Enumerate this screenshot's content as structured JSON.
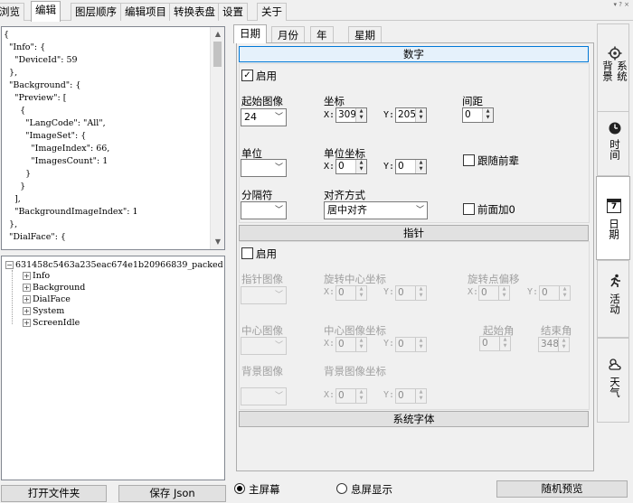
{
  "top_tabs": [
    "浏览",
    "编辑",
    "图层顺序",
    "编辑项目",
    "转换表盘",
    "设置",
    "关于"
  ],
  "active_top_tab": "编辑",
  "window_hint": "▾ ? ×",
  "json_lines": [
    "{",
    "  \"Info\": {",
    "    \"DeviceId\": 59",
    "  },",
    "  \"Background\": {",
    "    \"Preview\": [",
    "      {",
    "        \"LangCode\": \"All\",",
    "        \"ImageSet\": {",
    "          \"ImageIndex\": 66,",
    "          \"ImagesCount\": 1",
    "        }",
    "      }",
    "    ],",
    "    \"BackgroundImageIndex\": 1",
    "  },",
    "  \"DialFace\": {"
  ],
  "tree": {
    "root": "631458c5463a235eac674e1b20966839_packed",
    "children": [
      "Info",
      "Background",
      "DialFace",
      "System",
      "ScreenIdle"
    ]
  },
  "buttons": {
    "open_folder": "打开文件夹",
    "save_json": "保存 Json",
    "random_preview": "随机预览"
  },
  "sub_tabs": [
    "日期",
    "月份",
    "年",
    "星期"
  ],
  "active_sub_tab": "日期",
  "sections": {
    "number": {
      "header": "数字",
      "enable_label": "启用",
      "enabled": true,
      "start_image_label": "起始图像",
      "start_image_value": "24",
      "coord_label": "坐标",
      "x_label": "X:",
      "x_value": "309",
      "y_label": "Y:",
      "y_value": "205",
      "spacing_label": "间距",
      "spacing_value": "0",
      "unit_label": "单位",
      "unit_value": "",
      "unit_coord_label": "单位坐标",
      "unit_x_value": "0",
      "unit_y_value": "0",
      "follow_prev_label": "跟随前辈",
      "separator_label": "分隔符",
      "separator_value": "",
      "align_label": "对齐方式",
      "align_value": "居中对齐",
      "leading_zero_label": "前面加0"
    },
    "pointer": {
      "header": "指针",
      "enable_label": "启用",
      "enabled": false,
      "pointer_image_label": "指针图像",
      "rot_center_label": "旋转中心坐标",
      "rot_center_x": "0",
      "rot_center_y": "0",
      "rot_offset_label": "旋转点偏移",
      "rot_offset_x": "0",
      "rot_offset_y": "0",
      "center_image_label": "中心图像",
      "center_image_coord_label": "中心图像坐标",
      "center_x": "0",
      "center_y": "0",
      "start_angle_label": "起始角",
      "start_angle_value": "0",
      "end_angle_label": "结束角",
      "end_angle_value": "348",
      "bg_image_label": "背景图像",
      "bg_image_coord_label": "背景图像坐标",
      "bg_x": "0",
      "bg_y": "0"
    },
    "system_font": {
      "header": "系统字体"
    }
  },
  "right_tabs": [
    {
      "label": "系统",
      "icon": "gear-icon"
    },
    {
      "label": "背景",
      "icon": "background-icon"
    },
    {
      "label": "时间",
      "icon": "clock-icon"
    },
    {
      "label": "日期",
      "icon": "calendar-icon"
    },
    {
      "label": "活动",
      "icon": "activity-icon"
    },
    {
      "label": "天气",
      "icon": "weather-icon"
    }
  ],
  "calendar_icon_day": "7",
  "screen_options": {
    "main_screen": "主屏幕",
    "idle_screen": "息屏显示",
    "selected": "主屏幕"
  }
}
